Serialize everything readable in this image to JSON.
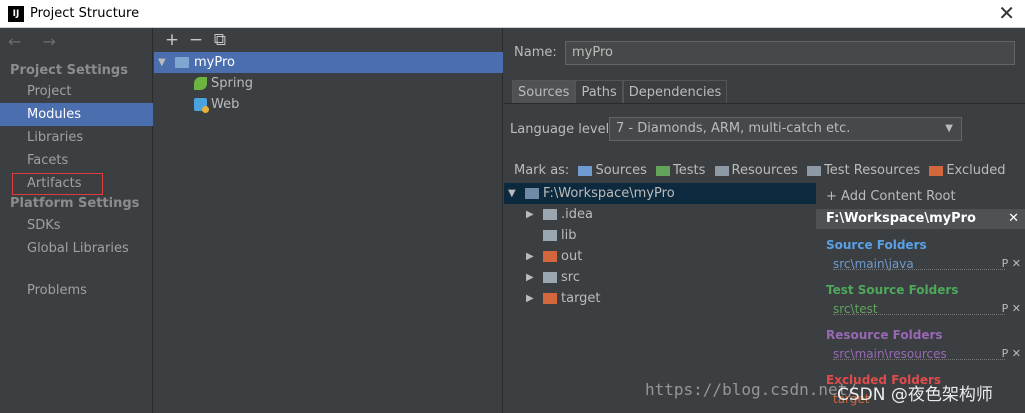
{
  "window": {
    "title": "Project Structure",
    "app_icon": "IJ",
    "close_glyph": "✕"
  },
  "left_panel": {
    "nav_arrows": "←  →",
    "project_settings_heading": "Project Settings",
    "project_settings_items": [
      "Project",
      "Modules",
      "Libraries",
      "Facets",
      "Artifacts"
    ],
    "selected_item": "Modules",
    "platform_settings_heading": "Platform Settings",
    "platform_settings_items": [
      "SDKs",
      "Global Libraries"
    ],
    "problems_label": "Problems"
  },
  "middle_panel": {
    "toolbar": {
      "add": "+",
      "remove": "−",
      "copy": "⧉"
    },
    "tree": [
      {
        "label": "myPro",
        "icon": "module-folder-icon",
        "selected": true,
        "expanded": true
      },
      {
        "label": "Spring",
        "icon": "spring-icon"
      },
      {
        "label": "Web",
        "icon": "web-icon"
      }
    ]
  },
  "right_panel": {
    "name_label": "Name:",
    "name_value": "myPro",
    "tabs": [
      "Sources",
      "Paths",
      "Dependencies"
    ],
    "active_tab": "Sources",
    "language_level_label": "Language level:",
    "language_level_value": "7 - Diamonds, ARM, multi-catch etc.",
    "mark_as_label": "Mark as:",
    "mark_as_options": [
      {
        "label": "Sources",
        "color": "#6e9bd0"
      },
      {
        "label": "Tests",
        "color": "#62a35a"
      },
      {
        "label": "Resources",
        "color": "#8d9aa6"
      },
      {
        "label": "Test Resources",
        "color": "#8d9aa6"
      },
      {
        "label": "Excluded",
        "color": "#d2663c"
      }
    ],
    "content_tree": {
      "root": "F:\\Workspace\\myPro",
      "children": [
        {
          "label": ".idea",
          "has_caret": true,
          "folder": "gray"
        },
        {
          "label": "lib",
          "has_caret": false,
          "folder": "gray"
        },
        {
          "label": "out",
          "has_caret": true,
          "folder": "orange"
        },
        {
          "label": "src",
          "has_caret": true,
          "folder": "gray"
        },
        {
          "label": "target",
          "has_caret": true,
          "folder": "orange"
        }
      ]
    },
    "content_roots": {
      "add_label": "+ Add Content Root",
      "root_path": "F:\\Workspace\\myPro",
      "groups": [
        {
          "title": "Source Folders",
          "path": "src\\main\\java",
          "title_color": "#5aa0e6",
          "path_color": "#6e9bd0"
        },
        {
          "title": "Test Source Folders",
          "path": "src\\test",
          "title_color": "#4fa85a",
          "path_color": "#62a35a"
        },
        {
          "title": "Resource Folders",
          "path": "src\\main\\resources",
          "title_color": "#9868b5",
          "path_color": "#9868b5"
        },
        {
          "title": "Excluded Folders",
          "path": "target",
          "title_color": "#e04b4b",
          "path_color": "#d2663c"
        }
      ]
    }
  },
  "watermark": {
    "url": "https://blog.csdn.net/",
    "text": "CSDN @夜色架构师"
  }
}
